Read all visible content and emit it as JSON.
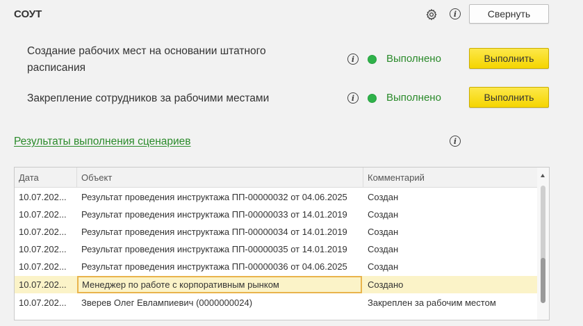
{
  "header": {
    "title": "СОУТ",
    "collapse_label": "Свернуть"
  },
  "scenarios": [
    {
      "label_line1": "Создание рабочих мест на основании штатного",
      "label_line2": "расписания",
      "status": "Выполнено",
      "button": "Выполнить"
    },
    {
      "label_line1": "Закрепление сотрудников за рабочими местами",
      "status": "Выполнено",
      "button": "Выполнить"
    }
  ],
  "results": {
    "link": "Результаты выполнения сценариев",
    "columns": {
      "date": "Дата",
      "object": "Объект",
      "comment": "Комментарий"
    },
    "rows": [
      {
        "date": "10.07.202...",
        "object": "Результат проведения инструктажа ПП-00000032 от 04.06.2025",
        "comment": "Создан"
      },
      {
        "date": "10.07.202...",
        "object": "Результат проведения инструктажа ПП-00000033 от 14.01.2019",
        "comment": "Создан"
      },
      {
        "date": "10.07.202...",
        "object": "Результат проведения инструктажа ПП-00000034 от 14.01.2019",
        "comment": "Создан"
      },
      {
        "date": "10.07.202...",
        "object": "Результат проведения инструктажа ПП-00000035 от 14.01.2019",
        "comment": "Создан"
      },
      {
        "date": "10.07.202...",
        "object": "Результат проведения инструктажа ПП-00000036 от 04.06.2025",
        "comment": "Создан"
      },
      {
        "date": "10.07.202...",
        "object": "Менеджер по работе с корпоративным рынком",
        "comment": "Создано"
      },
      {
        "date": "10.07.202...",
        "object": "Зверев Олег Евлампиевич (0000000024)",
        "comment": "Закреплен за рабочим местом"
      }
    ]
  },
  "colors": {
    "status_green": "#2fb24a",
    "link_green": "#2a8a2a",
    "accent_yellow": "#f5d500",
    "selected_row": "#fbf3c8",
    "focus_border": "#e9b44c"
  },
  "icons": [
    "gear-icon",
    "info-icon",
    "status-dot-icon",
    "scroll-up-icon"
  ]
}
